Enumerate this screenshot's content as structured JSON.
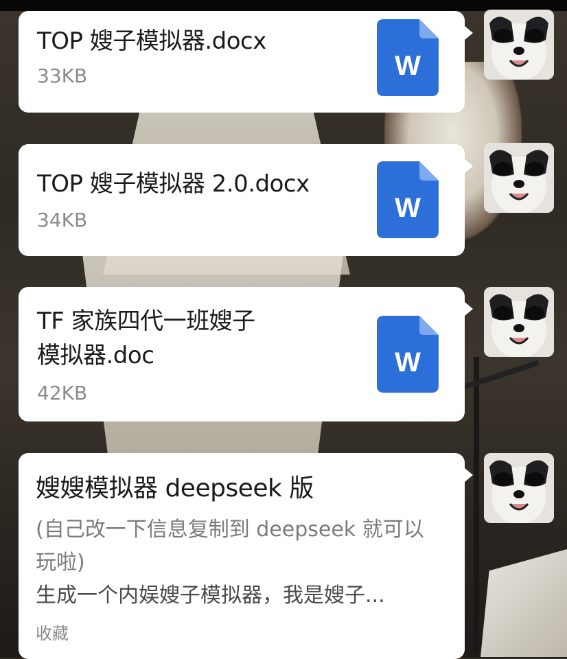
{
  "messages": [
    {
      "title_line1": "TOP 嫂子模拟器.docx",
      "size": "33KB",
      "icon": "word-doc-icon",
      "icon_letter": "W"
    },
    {
      "title_line1": "TOP 嫂子模拟器 2.0.docx",
      "size": "34KB",
      "icon": "word-doc-icon",
      "icon_letter": "W"
    },
    {
      "title_line1": "TF 家族四代一班嫂子",
      "title_line2": "模拟器.doc",
      "size": "42KB",
      "icon": "word-doc-icon",
      "icon_letter": "W"
    }
  ],
  "text_message": {
    "title": "嫂嫂模拟器 deepseek 版",
    "description": "(自己改一下信息复制到 deepseek 就可以玩啦)",
    "preview": "生成一个内娱嫂子模拟器，我是嫂子...",
    "footer": "收藏"
  },
  "colors": {
    "word_blue": "#2d6fd9",
    "card_bg": "#ffffff",
    "title_text": "#1b1b1b",
    "meta_text": "#8a8a8a"
  },
  "avatar": {
    "icon": "dog-avatar-icon"
  }
}
